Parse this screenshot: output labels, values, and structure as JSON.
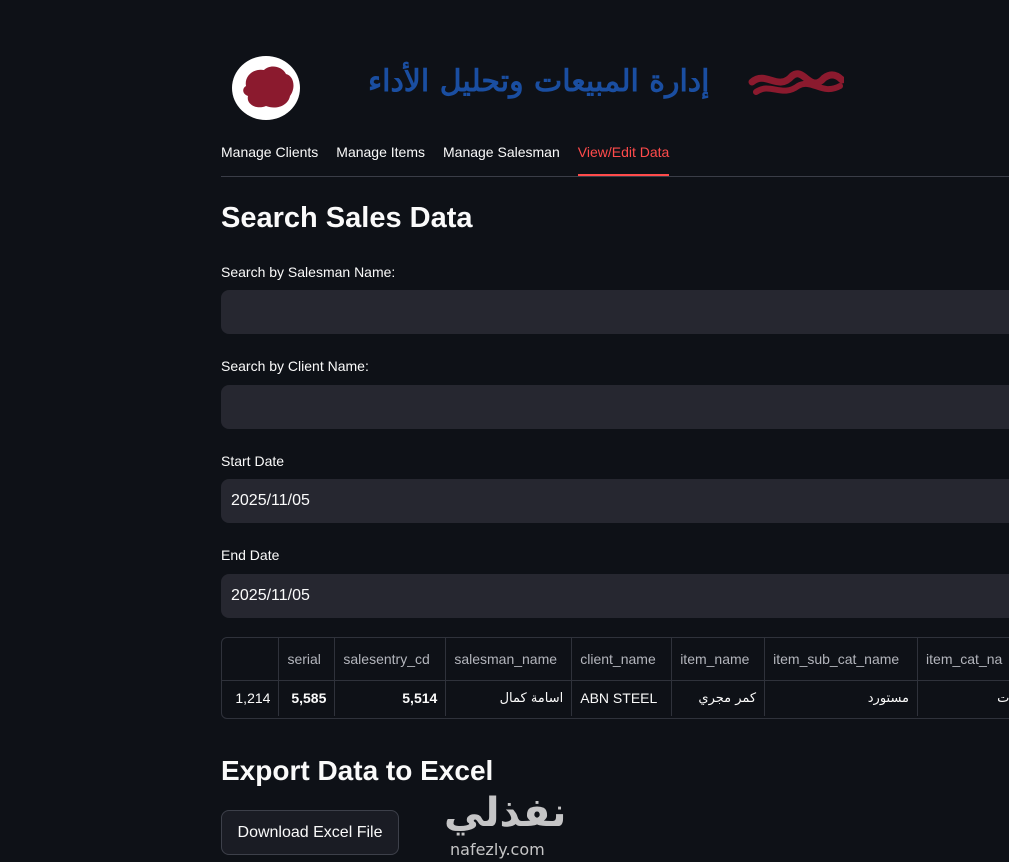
{
  "header": {
    "banner_title": "إدارة المبيعات وتحليل الأداء"
  },
  "tabs": [
    {
      "label": "Manage Clients",
      "active": false
    },
    {
      "label": "Manage Items",
      "active": false
    },
    {
      "label": "Manage Salesman",
      "active": false
    },
    {
      "label": "View/Edit Data",
      "active": true
    }
  ],
  "colors": {
    "background": "#0e1117",
    "accent": "#ff4b4b",
    "input_bg": "#262730",
    "banner_blue": "#1a4ea1",
    "logo_red": "#8b1a2e"
  },
  "search": {
    "title": "Search Sales Data",
    "salesman_label": "Search by Salesman Name:",
    "salesman_value": "",
    "client_label": "Search by Client Name:",
    "client_value": "",
    "start_label": "Start Date",
    "start_value": "2025/11/05",
    "end_label": "End Date",
    "end_value": "2025/11/05"
  },
  "table": {
    "columns": [
      "",
      "serial",
      "salesentry_cd",
      "salesman_name",
      "client_name",
      "item_name",
      "item_sub_cat_name",
      "item_cat_na"
    ],
    "rows": [
      {
        "index": "1,214",
        "serial": "5,585",
        "salesentry_cd": "5,514",
        "salesman_name": "اسامة كمال",
        "client_name": "ABN STEEL",
        "item_name": "كمر مجري",
        "item_sub_cat_name": "مستورد",
        "item_cat_name": "ات"
      }
    ]
  },
  "export": {
    "title": "Export Data to Excel",
    "button_label": "Download Excel File"
  },
  "watermark": {
    "arabic": "نفذلي",
    "latin": "nafezly.com"
  }
}
